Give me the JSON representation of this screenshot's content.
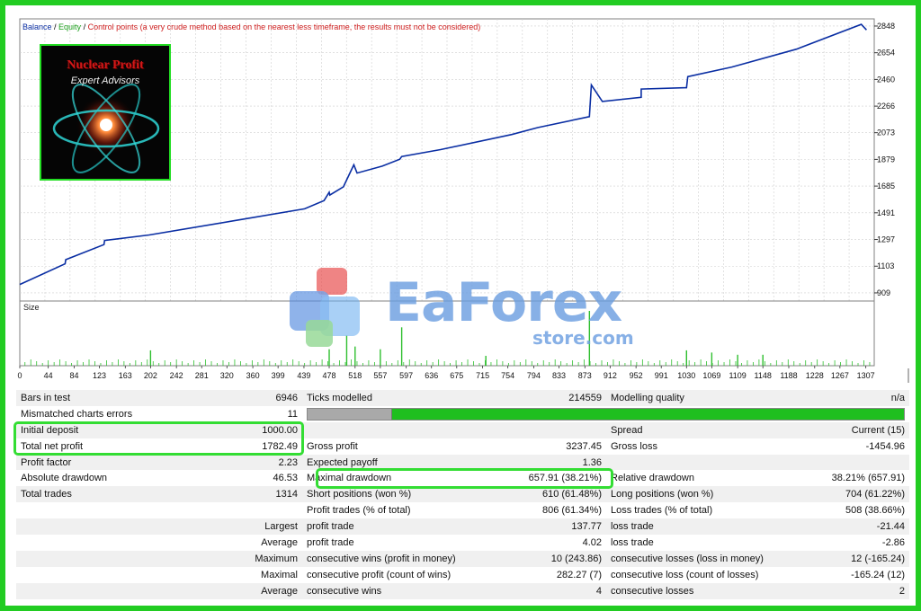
{
  "legend": {
    "balance": "Balance",
    "sep1": " / ",
    "equity": "Equity",
    "sep2": " / ",
    "control": "Control points (a very crude method based on the nearest less timeframe, the results must not be considered)"
  },
  "logo": {
    "title": "Nuclear Profit",
    "subtitle": "Expert Advisors"
  },
  "watermark": {
    "text": "EaForex",
    "sub": "store.com"
  },
  "colors": {
    "frame": "#22cc22",
    "balance": "#0a2ea3",
    "size": "#2fbf2f",
    "highlight": "#33dd33",
    "progress_bar": "#1fbf1f"
  },
  "chart_data": [
    {
      "type": "line",
      "name": "balance",
      "ylim": [
        850,
        2900
      ],
      "xlim": [
        0,
        1320
      ],
      "y_ticks": [
        "909",
        "1103",
        "1297",
        "1491",
        "1685",
        "1879",
        "2073",
        "2266",
        "2460",
        "2654",
        "2848"
      ],
      "grid": true,
      "x": [
        0,
        70,
        71,
        130,
        131,
        200,
        340,
        440,
        470,
        478,
        479,
        500,
        516,
        521,
        560,
        587,
        590,
        650,
        760,
        800,
        880,
        883,
        900,
        960,
        960,
        1030,
        1032,
        1100,
        1200,
        1300,
        1308
      ],
      "y": [
        970,
        1120,
        1150,
        1260,
        1290,
        1330,
        1440,
        1520,
        1580,
        1640,
        1620,
        1680,
        1840,
        1780,
        1830,
        1880,
        1900,
        1950,
        2060,
        2110,
        2190,
        2420,
        2300,
        2330,
        2390,
        2400,
        2480,
        2550,
        2680,
        2860,
        2820
      ]
    },
    {
      "type": "bar",
      "name": "size",
      "title": "Size",
      "x_ticks": [
        "0",
        "44",
        "84",
        "123",
        "163",
        "202",
        "242",
        "281",
        "320",
        "360",
        "399",
        "439",
        "478",
        "518",
        "557",
        "597",
        "636",
        "675",
        "715",
        "754",
        "794",
        "833",
        "873",
        "912",
        "952",
        "991",
        "1030",
        "1069",
        "1109",
        "1148",
        "1188",
        "1228",
        "1267",
        "1307"
      ],
      "spikes": [
        {
          "x": 202,
          "value": 0.28
        },
        {
          "x": 478,
          "value": 0.3
        },
        {
          "x": 505,
          "value": 0.55
        },
        {
          "x": 518,
          "value": 0.35
        },
        {
          "x": 557,
          "value": 0.3
        },
        {
          "x": 590,
          "value": 0.7
        },
        {
          "x": 720,
          "value": 0.18
        },
        {
          "x": 880,
          "value": 1.0
        },
        {
          "x": 1030,
          "value": 0.28
        },
        {
          "x": 1069,
          "value": 0.24
        },
        {
          "x": 1109,
          "value": 0.2
        },
        {
          "x": 1148,
          "value": 0.2
        }
      ]
    }
  ],
  "stats": {
    "rows": [
      [
        "Bars in test",
        "6946",
        "Ticks modelled",
        "214559",
        "Modelling quality",
        "n/a"
      ],
      [
        "Mismatched charts errors",
        "11",
        "__bar__",
        "",
        "",
        ""
      ],
      [
        "Initial deposit",
        "1000.00",
        "",
        "",
        "Spread",
        "Current (15)"
      ],
      [
        "Total net profit",
        "1782.49",
        "Gross profit",
        "3237.45",
        "Gross loss",
        "-1454.96"
      ],
      [
        "Profit factor",
        "2.23",
        "Expected payoff",
        "1.36",
        "",
        ""
      ],
      [
        "Absolute drawdown",
        "46.53",
        "Maximal drawdown",
        "657.91 (38.21%)",
        "Relative drawdown",
        "38.21% (657.91)"
      ],
      [
        "Total trades",
        "1314",
        "Short positions (won %)",
        "610 (61.48%)",
        "Long positions (won %)",
        "704 (61.22%)"
      ],
      [
        "",
        "",
        "Profit trades (% of total)",
        "806 (61.34%)",
        "Loss trades (% of total)",
        "508 (38.66%)"
      ],
      [
        "",
        "Largest",
        "profit trade",
        "137.77",
        "loss trade",
        "-21.44"
      ],
      [
        "",
        "Average",
        "profit trade",
        "4.02",
        "loss trade",
        "-2.86"
      ],
      [
        "",
        "Maximum",
        "consecutive wins (profit in money)",
        "10 (243.86)",
        "consecutive losses (loss in money)",
        "12 (-165.24)"
      ],
      [
        "",
        "Maximal",
        "consecutive profit (count of wins)",
        "282.27 (7)",
        "consecutive loss (count of losses)",
        "-165.24 (12)"
      ],
      [
        "",
        "Average",
        "consecutive wins",
        "4",
        "consecutive losses",
        "2"
      ]
    ]
  }
}
